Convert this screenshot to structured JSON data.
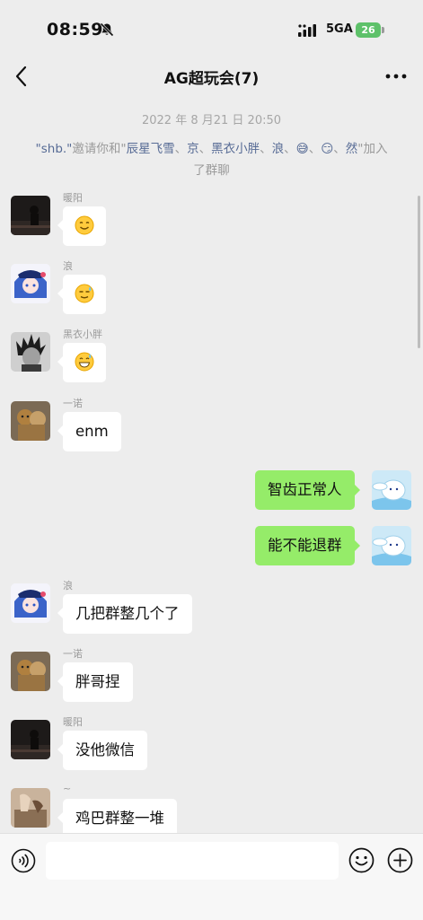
{
  "status_bar": {
    "time": "08:59",
    "network": "5GA",
    "battery": "26"
  },
  "header": {
    "title": "AG超玩会(7)"
  },
  "system": {
    "timestamp": "2022 年 8 月21 日 20:50",
    "inviter": "\"shb.\"",
    "invite_text": "邀请你和\"",
    "invitees": [
      {
        "name": "辰星飞雪",
        "sep": "、"
      },
      {
        "name": "京",
        "sep": "、"
      },
      {
        "name": "黑衣小胖",
        "sep": "、"
      },
      {
        "name": "浪",
        "sep": "、"
      },
      {
        "name": "😅",
        "sep": "、"
      },
      {
        "name": "😏",
        "sep": "、"
      },
      {
        "name": "然",
        "sep": ""
      }
    ],
    "join_text": "\"加入了群聊"
  },
  "messages": [
    {
      "side": "left",
      "sender": "暖阳",
      "emoji": "smiling-face"
    },
    {
      "side": "left",
      "sender": "浪",
      "emoji": "sweat-smile-face"
    },
    {
      "side": "left",
      "sender": "黑衣小胖",
      "emoji": "grinning-sweat-face"
    },
    {
      "side": "left",
      "sender": "一诺",
      "text": "enm"
    },
    {
      "side": "right",
      "text": "智齿正常人"
    },
    {
      "side": "right",
      "text": "能不能退群"
    },
    {
      "side": "left",
      "sender": "浪",
      "text": "几把群整几个了"
    },
    {
      "side": "left",
      "sender": "一诺",
      "text": "胖哥捏"
    },
    {
      "side": "left",
      "sender": "暖阳",
      "text": "没他微信"
    },
    {
      "side": "left",
      "sender": "~",
      "text": "鸡巴群整一堆"
    }
  ],
  "colors": {
    "self_bubble": "#95ec69",
    "other_bubble": "#ffffff",
    "link": "#576b95",
    "background": "#ededed"
  },
  "icons": {
    "back": "chevron-left-icon",
    "more": "ellipsis-icon",
    "voice": "voice-icon",
    "emoji": "smiley-icon",
    "plus": "plus-circle-icon",
    "mute": "bell-off-icon"
  }
}
